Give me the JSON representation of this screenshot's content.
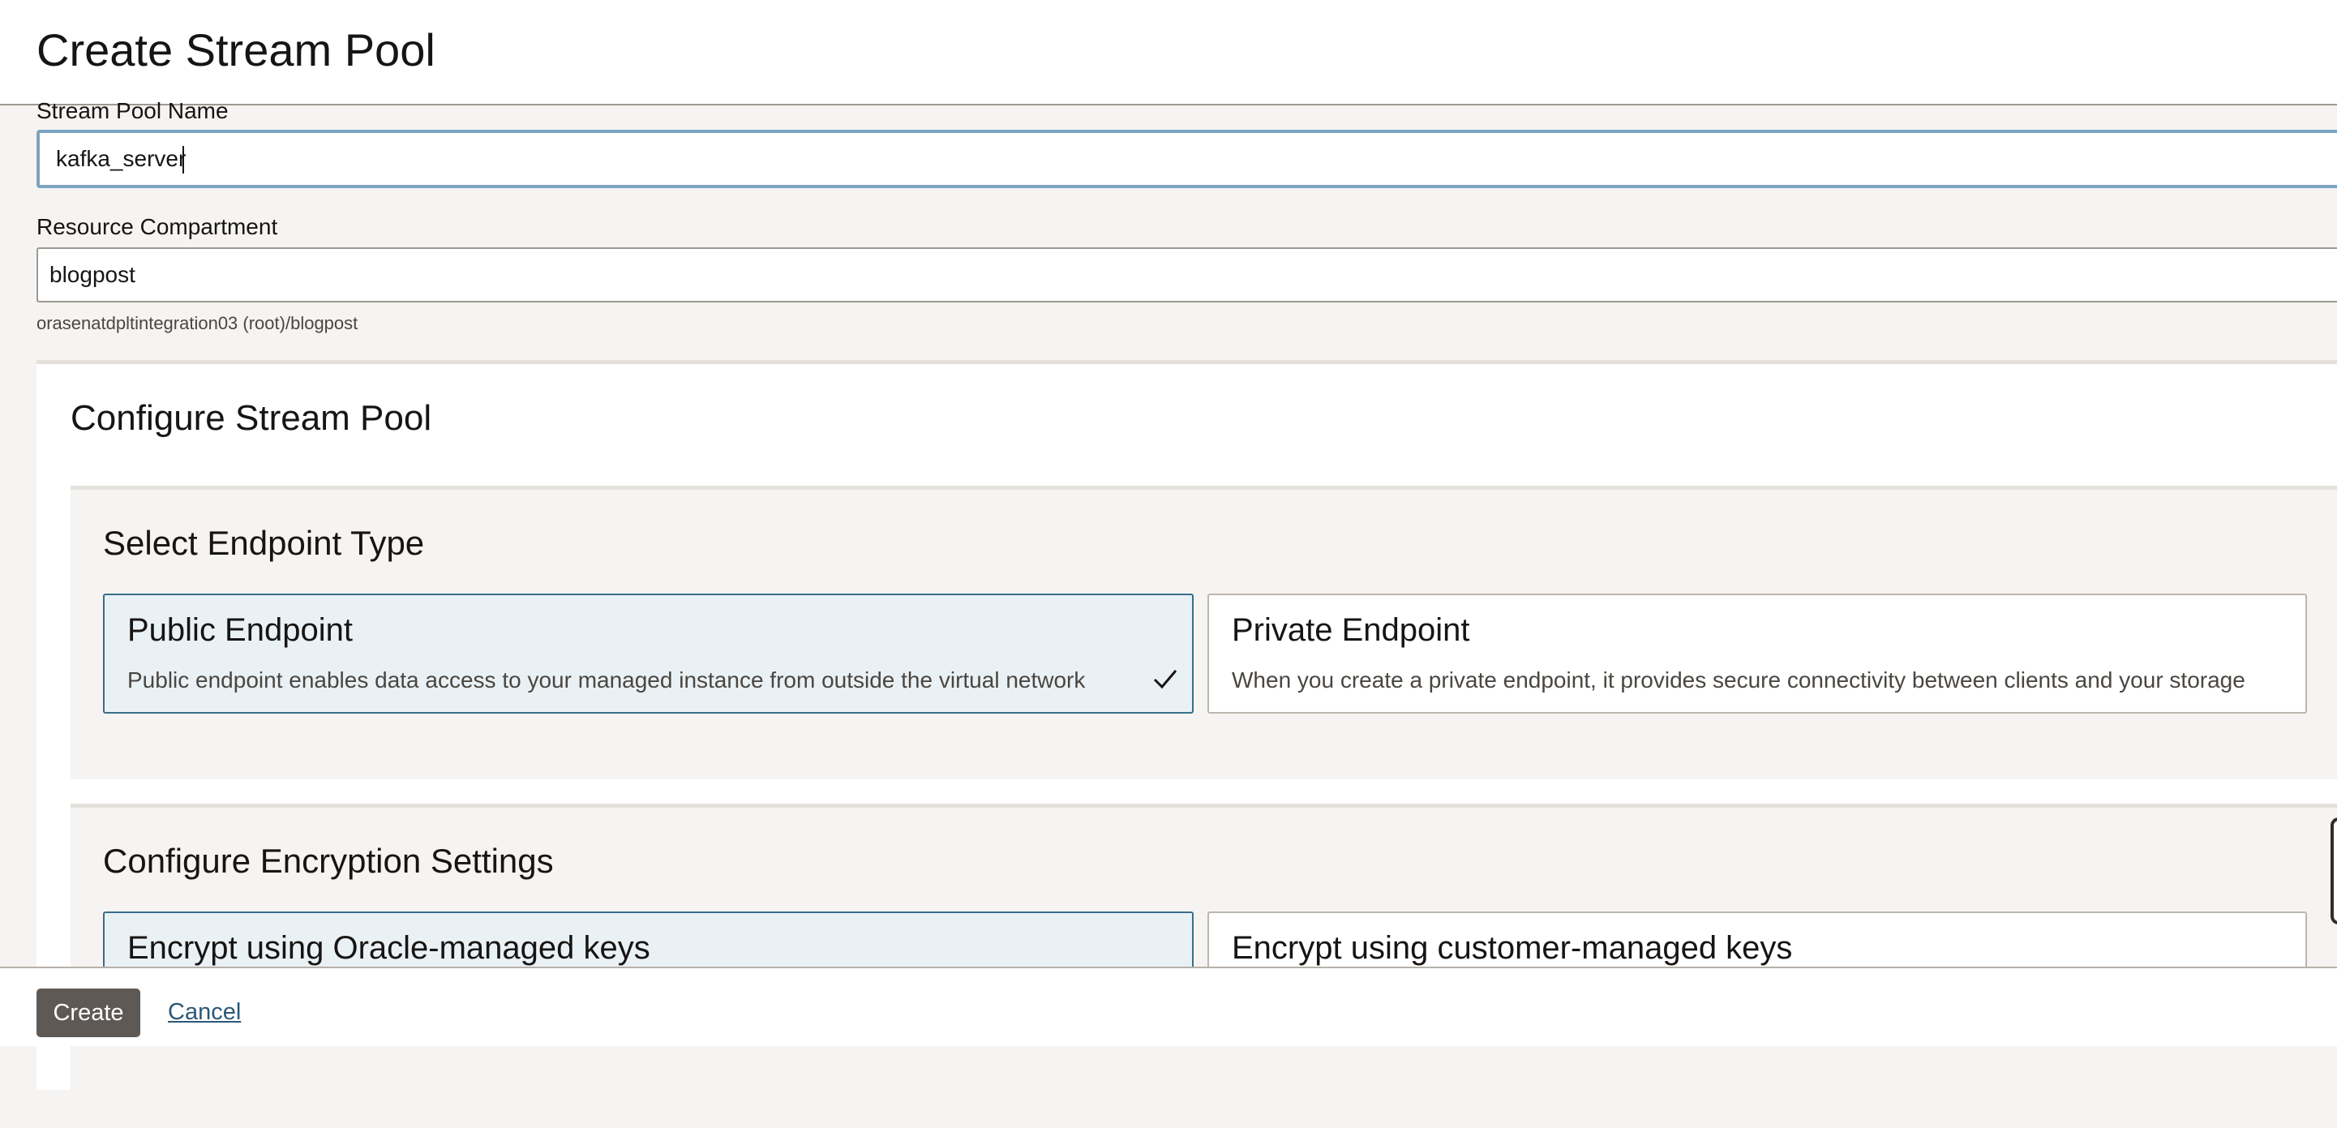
{
  "header": {
    "title": "Create Stream Pool"
  },
  "form": {
    "name_label": "Stream Pool Name",
    "name_value": "kafka_server",
    "compartment_label": "Resource Compartment",
    "compartment_value": "blogpost",
    "compartment_path": "orasenatdpltintegration03 (root)/blogpost"
  },
  "configure": {
    "title": "Configure Stream Pool",
    "endpoint": {
      "title": "Select Endpoint Type",
      "selected": "public",
      "options": [
        {
          "title": "Public Endpoint",
          "description": "Public endpoint enables data access to your managed instance from outside the virtual network"
        },
        {
          "title": "Private Endpoint",
          "description": "When you create a private endpoint, it provides secure connectivity between clients and your storage"
        }
      ]
    },
    "encryption": {
      "title": "Configure Encryption Settings",
      "selected": "oracle",
      "options": [
        {
          "title": "Encrypt using Oracle-managed keys"
        },
        {
          "title": "Encrypt using customer-managed keys"
        }
      ]
    }
  },
  "footer": {
    "create_label": "Create",
    "cancel_label": "Cancel"
  },
  "colors": {
    "accent_border": "#3a6d8c",
    "selected_bg": "#eaf1f4",
    "primary_button": "#5f5955",
    "link": "#2c5875"
  },
  "icons": {
    "selected_check": "check-icon"
  }
}
